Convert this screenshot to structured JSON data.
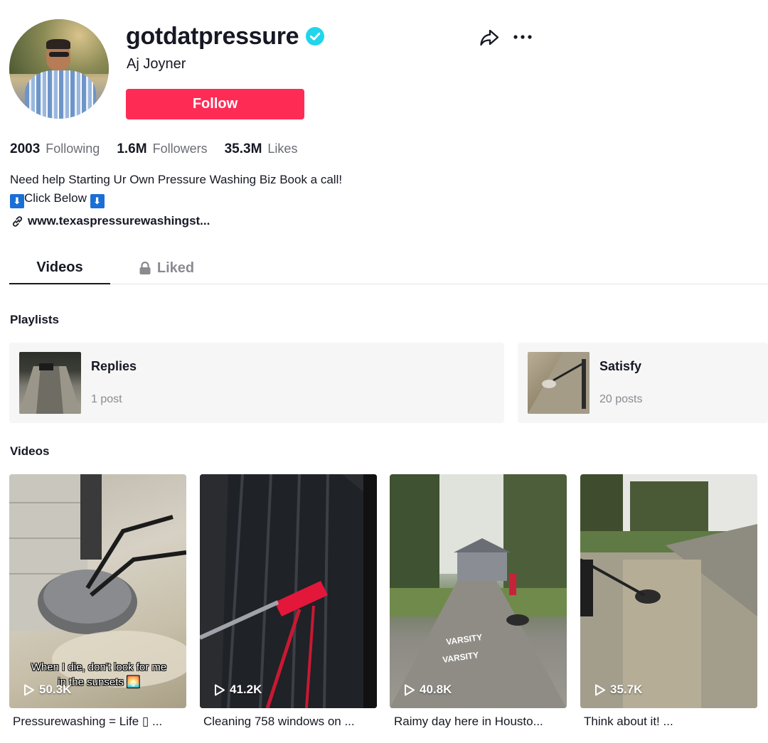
{
  "profile": {
    "username": "gotdatpressure",
    "nickname": "Aj Joyner",
    "follow_label": "Follow"
  },
  "stats": [
    {
      "value": "2003",
      "label": "Following"
    },
    {
      "value": "1.6M",
      "label": "Followers"
    },
    {
      "value": "35.3M",
      "label": "Likes"
    }
  ],
  "bio": {
    "line1": "Need help Starting Ur Own Pressure Washing Biz Book a call!",
    "line2_arrow_left": "⬇",
    "line2_text": "Click Below",
    "line2_arrow_right": "⬇"
  },
  "link": "www.texaspressurewashingst...",
  "tabs": [
    {
      "label": "Videos",
      "active": true
    },
    {
      "label": "Liked",
      "active": false,
      "icon": "lock-icon"
    }
  ],
  "playlists_title": "Playlists",
  "playlists": [
    {
      "title": "Replies",
      "count": "1 post"
    },
    {
      "title": "Satisfy",
      "count": "20 posts"
    }
  ],
  "videos_title": "Videos",
  "videos": [
    {
      "views": "50.3K",
      "caption": "Pressurewashing = Life ▯ ...",
      "overlay_text": "When I die, don't look for me in the sunsets 🌅"
    },
    {
      "views": "41.2K",
      "caption": "Cleaning 758 windows on ..."
    },
    {
      "views": "40.8K",
      "caption": "Raimy day here in Housto..."
    },
    {
      "views": "35.7K",
      "caption": "Think about it! ..."
    }
  ],
  "colors": {
    "accent": "#fe2c55",
    "verified": "#20d5ec",
    "text": "#161823",
    "muted": "#8a8b91"
  }
}
